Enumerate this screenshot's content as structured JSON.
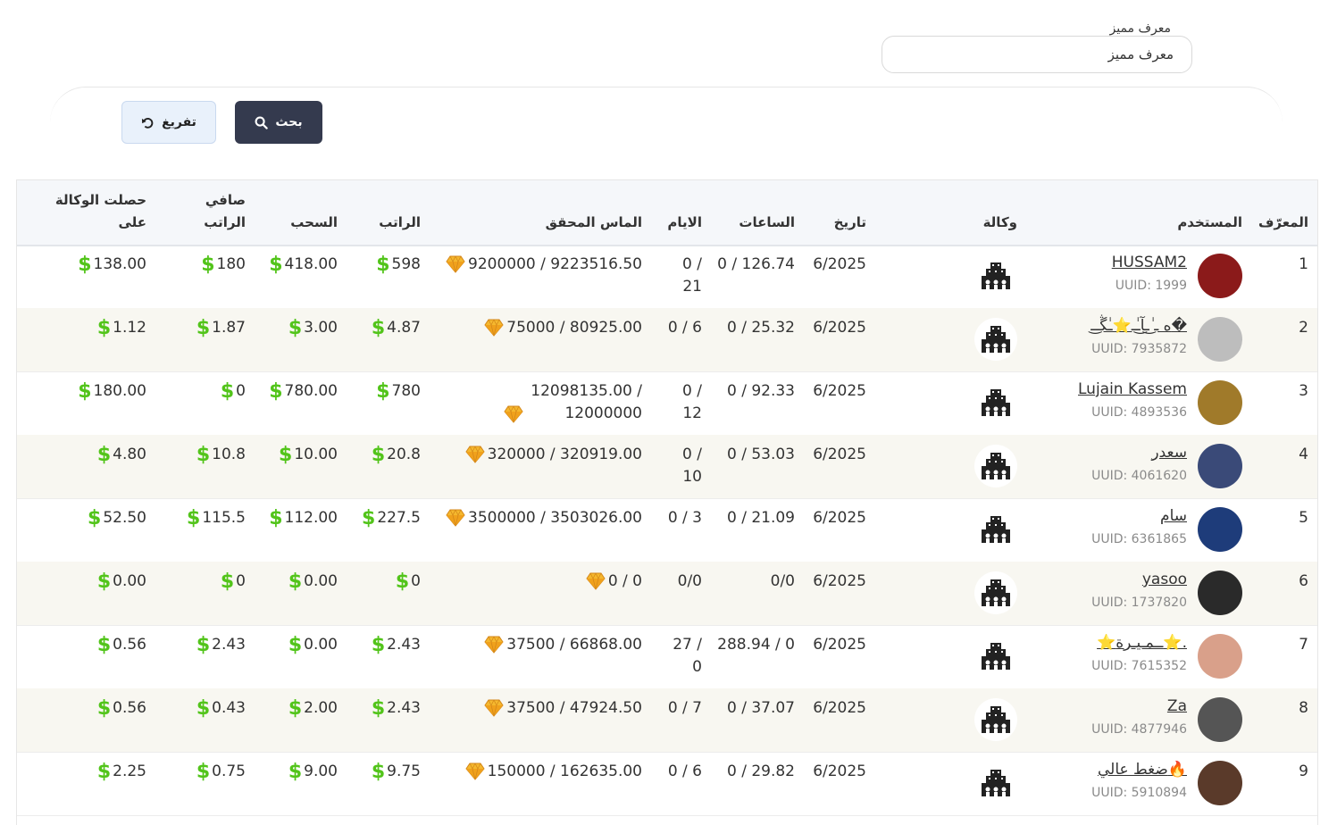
{
  "search": {
    "label": "معرف مميز",
    "placeholder": "معرف مميز"
  },
  "buttons": {
    "search_label": "بحث",
    "reset_label": "تفريغ"
  },
  "colors": {
    "dollar": "#52c41a",
    "primary_button": "#343a4e",
    "reset_button": "#e9f1fb",
    "row_alt": "#f8f7f1"
  },
  "table": {
    "headers": {
      "id": "المعرّف",
      "user": "المستخدم",
      "agency": "وكالة",
      "date": "تاريخ",
      "hours": "الساعات",
      "days": "الايام",
      "diamonds": "الماس المحقق",
      "salary": "الراتب",
      "withdraw": "السحب",
      "net_salary": "صافي الراتب",
      "agency_got": "حصلت الوكالة على"
    },
    "rows": [
      {
        "id": "1",
        "name": "HUSSAM2",
        "uuid": "UUID: 1999",
        "date": "6/2025",
        "hours": "0 / 126.74",
        "days": "0 / 21",
        "diamonds": "9200000 / 9223516.50",
        "salary": "598",
        "withdraw": "418.00",
        "net": "180",
        "agency_got": "138.00",
        "avatar_color": "#8b1a1a"
      },
      {
        "id": "2",
        "name": "ه ـ ٰ͜ـآ͜ـٰـ⭐ـٰڴـ͜ـ�",
        "uuid": "UUID: 7935872",
        "date": "6/2025",
        "hours": "0 / 25.32",
        "days": "0 / 6",
        "diamonds": "75000 / 80925.00",
        "salary": "4.87",
        "withdraw": "3.00",
        "net": "1.87",
        "agency_got": "1.12",
        "avatar_color": "#bdbdbd"
      },
      {
        "id": "3",
        "name": "Lujain Kassem",
        "uuid": "UUID: 4893536",
        "date": "6/2025",
        "hours": "0 / 92.33",
        "days": "0 / 12",
        "diamonds": "12098135.00 / 12000000",
        "salary": "780",
        "withdraw": "780.00",
        "net": "0",
        "agency_got": "180.00",
        "avatar_color": "#a07a2a"
      },
      {
        "id": "4",
        "name": "سعدر",
        "uuid": "UUID: 4061620",
        "date": "6/2025",
        "hours": "0 / 53.03",
        "days": "0 / 10",
        "diamonds": "320000 / 320919.00",
        "salary": "20.8",
        "withdraw": "10.00",
        "net": "10.8",
        "agency_got": "4.80",
        "avatar_color": "#3a4a78"
      },
      {
        "id": "5",
        "name": "سام",
        "uuid": "UUID: 6361865",
        "date": "6/2025",
        "hours": "0 / 21.09",
        "days": "0 / 3",
        "diamonds": "3500000 / 3503026.00",
        "salary": "227.5",
        "withdraw": "112.00",
        "net": "115.5",
        "agency_got": "52.50",
        "avatar_color": "#1e3c7a"
      },
      {
        "id": "6",
        "name": "yasoo",
        "uuid": "UUID: 1737820",
        "date": "6/2025",
        "hours": "0/0",
        "days": "0/0",
        "diamonds": "0 / 0",
        "salary": "0",
        "withdraw": "0.00",
        "net": "0",
        "agency_got": "0.00",
        "avatar_color": "#2a2a2a"
      },
      {
        "id": "7",
        "name": "⭐ــمـيـرة⭐.",
        "uuid": "UUID: 7615352",
        "date": "6/2025",
        "hours": "288.94 / 0",
        "days": "27 / 0",
        "diamonds": "37500 / 66868.00",
        "salary": "2.43",
        "withdraw": "0.00",
        "net": "2.43",
        "agency_got": "0.56",
        "avatar_color": "#d9a08a"
      },
      {
        "id": "8",
        "name": "Za",
        "uuid": "UUID: 4877946",
        "date": "6/2025",
        "hours": "0 / 37.07",
        "days": "0 / 7",
        "diamonds": "37500 / 47924.50",
        "salary": "2.43",
        "withdraw": "2.00",
        "net": "0.43",
        "agency_got": "0.56",
        "avatar_color": "#555555"
      },
      {
        "id": "9",
        "name": "ضغط عالي🔥",
        "uuid": "UUID: 5910894",
        "date": "6/2025",
        "hours": "0 / 29.82",
        "days": "0 / 6",
        "diamonds": "150000 / 162635.00",
        "salary": "9.75",
        "withdraw": "9.00",
        "net": "0.75",
        "agency_got": "2.25",
        "avatar_color": "#5a3a2a"
      }
    ]
  }
}
